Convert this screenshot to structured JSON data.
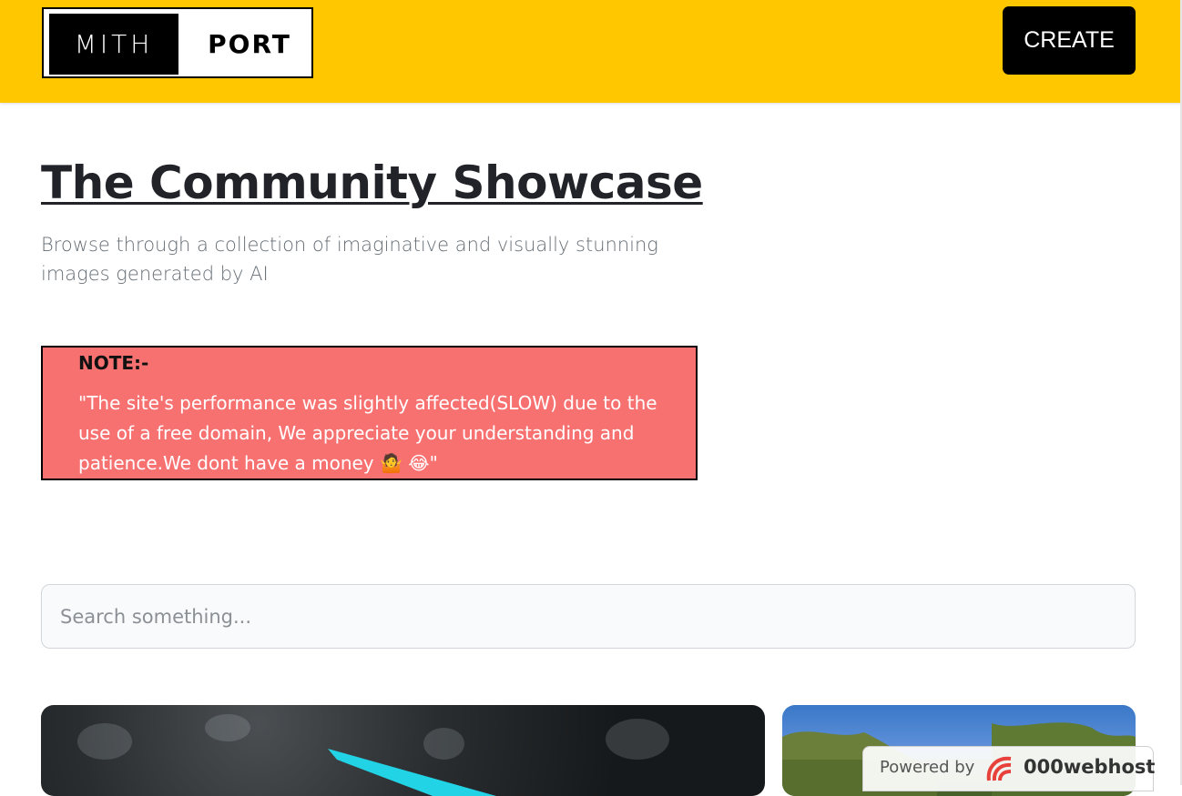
{
  "header": {
    "logo_left": "MITH",
    "logo_right": "PORT",
    "create_label": "CREATE",
    "background": "#ffc700"
  },
  "main": {
    "title": "The Community Showcase",
    "subtitle": "Browse through a collection of imaginative and visually stunning images generated by AI"
  },
  "note": {
    "heading": "NOTE:-",
    "body": "\"The site's performance was slightly affected(SLOW) due to the use of a free domain, We appreciate your understanding and patience.We dont have a money 🤷 😂\"",
    "background": "#f87171"
  },
  "search": {
    "placeholder": "Search something..."
  },
  "badge": {
    "powered_by": "Powered by",
    "brand": "000webhost"
  }
}
